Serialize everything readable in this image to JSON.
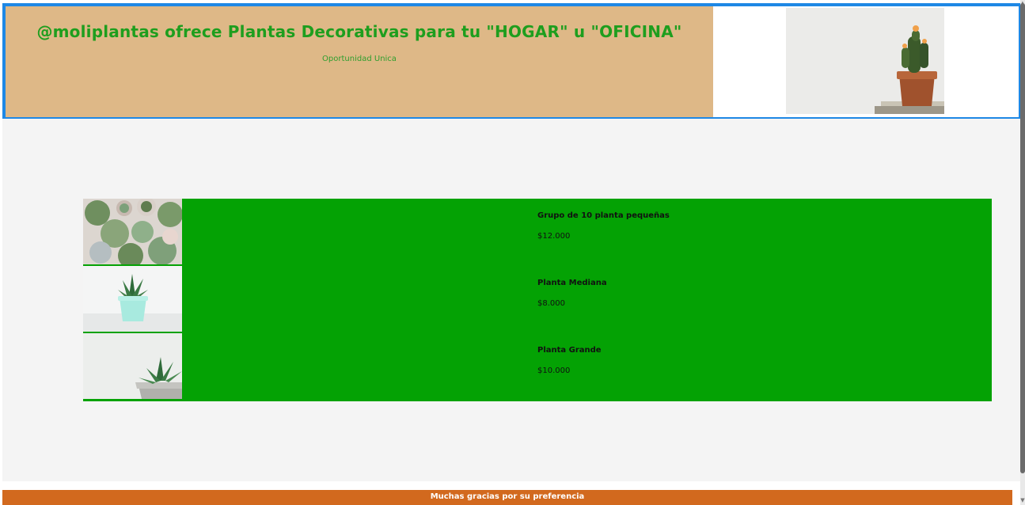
{
  "header": {
    "title": "@moliplantas ofrece Plantas Decorativas para tu \"HOGAR\" u \"OFICINA\"",
    "subtitle": "Oportunidad Unica",
    "hero_image": "potted-cactus-photo"
  },
  "products": [
    {
      "image": "succulent-group-photo",
      "name": "Grupo de 10 planta pequeñas",
      "price": "$12.000"
    },
    {
      "image": "aloe-mint-pot-photo",
      "name": "Planta Mediana",
      "price": "$8.000"
    },
    {
      "image": "succulent-grey-pot-photo",
      "name": "Planta Grande",
      "price": "$10.000"
    }
  ],
  "footer": {
    "text": "Muchas gracias por su preferencia"
  },
  "colors": {
    "header_bg": "#deb887",
    "header_border": "#1e88e5",
    "title_color": "#1e9e1e",
    "product_bg": "#04a204",
    "main_bg": "#f4f4f4",
    "footer_bg": "#d2691e"
  }
}
